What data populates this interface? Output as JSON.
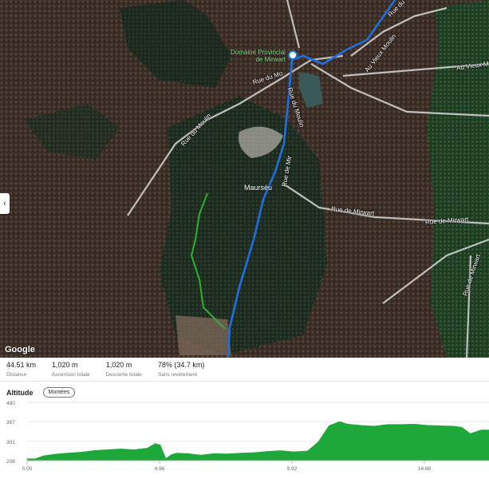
{
  "map": {
    "poi_line1": "Domaine Provincial",
    "poi_line2": "de Mirwart",
    "place": "Maurséu",
    "roads": [
      "Rue du Moulin",
      "Rue de Mirwart",
      "Rue de Mirwart",
      "Au Vieux Moulin",
      "Au Vieux M",
      "Rue du",
      "Rue de Mirwart",
      "Rue du Mo",
      "Rue de Mir",
      "Rue du Moulin"
    ],
    "attribution": "Google",
    "collapse_icon": "chevron-left-icon"
  },
  "stats": [
    {
      "value": "44.51 km",
      "label": "Distance"
    },
    {
      "value": "1,020 m",
      "label": "Ascension totale"
    },
    {
      "value": "1,020 m",
      "label": "Descente totale"
    },
    {
      "value": "78% (34.7 km)",
      "label": "Sans revêtement"
    }
  ],
  "altitude": {
    "title": "Altitude",
    "button": "Montées"
  },
  "chart_data": {
    "type": "area",
    "title": "Altitude",
    "xlabel": "",
    "ylabel": "",
    "x_ticks": [
      "0.00",
      "4.96",
      "9.92",
      "14.88"
    ],
    "y_ticks": [
      "490",
      "397",
      "301",
      "208"
    ],
    "ylim": [
      208,
      490
    ],
    "xlim": [
      0,
      17.3
    ],
    "color": "#1ea83a",
    "x": [
      0,
      0.3,
      0.6,
      1.0,
      1.5,
      2.0,
      2.5,
      3.0,
      3.5,
      4.0,
      4.5,
      4.8,
      5.0,
      5.2,
      5.4,
      5.6,
      6.0,
      6.5,
      7.0,
      7.5,
      8.0,
      8.5,
      9.0,
      9.5,
      10.0,
      10.5,
      10.9,
      11.3,
      11.7,
      12.0,
      12.5,
      13.0,
      13.5,
      14.0,
      14.5,
      15.0,
      15.5,
      16.0,
      16.3,
      16.6,
      17.0,
      17.3
    ],
    "y": [
      218,
      218,
      232,
      240,
      246,
      250,
      258,
      262,
      266,
      262,
      270,
      292,
      284,
      220,
      238,
      246,
      244,
      236,
      244,
      242,
      246,
      248,
      254,
      258,
      252,
      256,
      300,
      378,
      398,
      386,
      380,
      376,
      384,
      384,
      386,
      380,
      378,
      376,
      370,
      340,
      358,
      358
    ]
  },
  "colors": {
    "accent": "#1976d2",
    "route": "#1f6fe0",
    "alt_route": "#2fb12f",
    "area": "#1ea83a"
  }
}
